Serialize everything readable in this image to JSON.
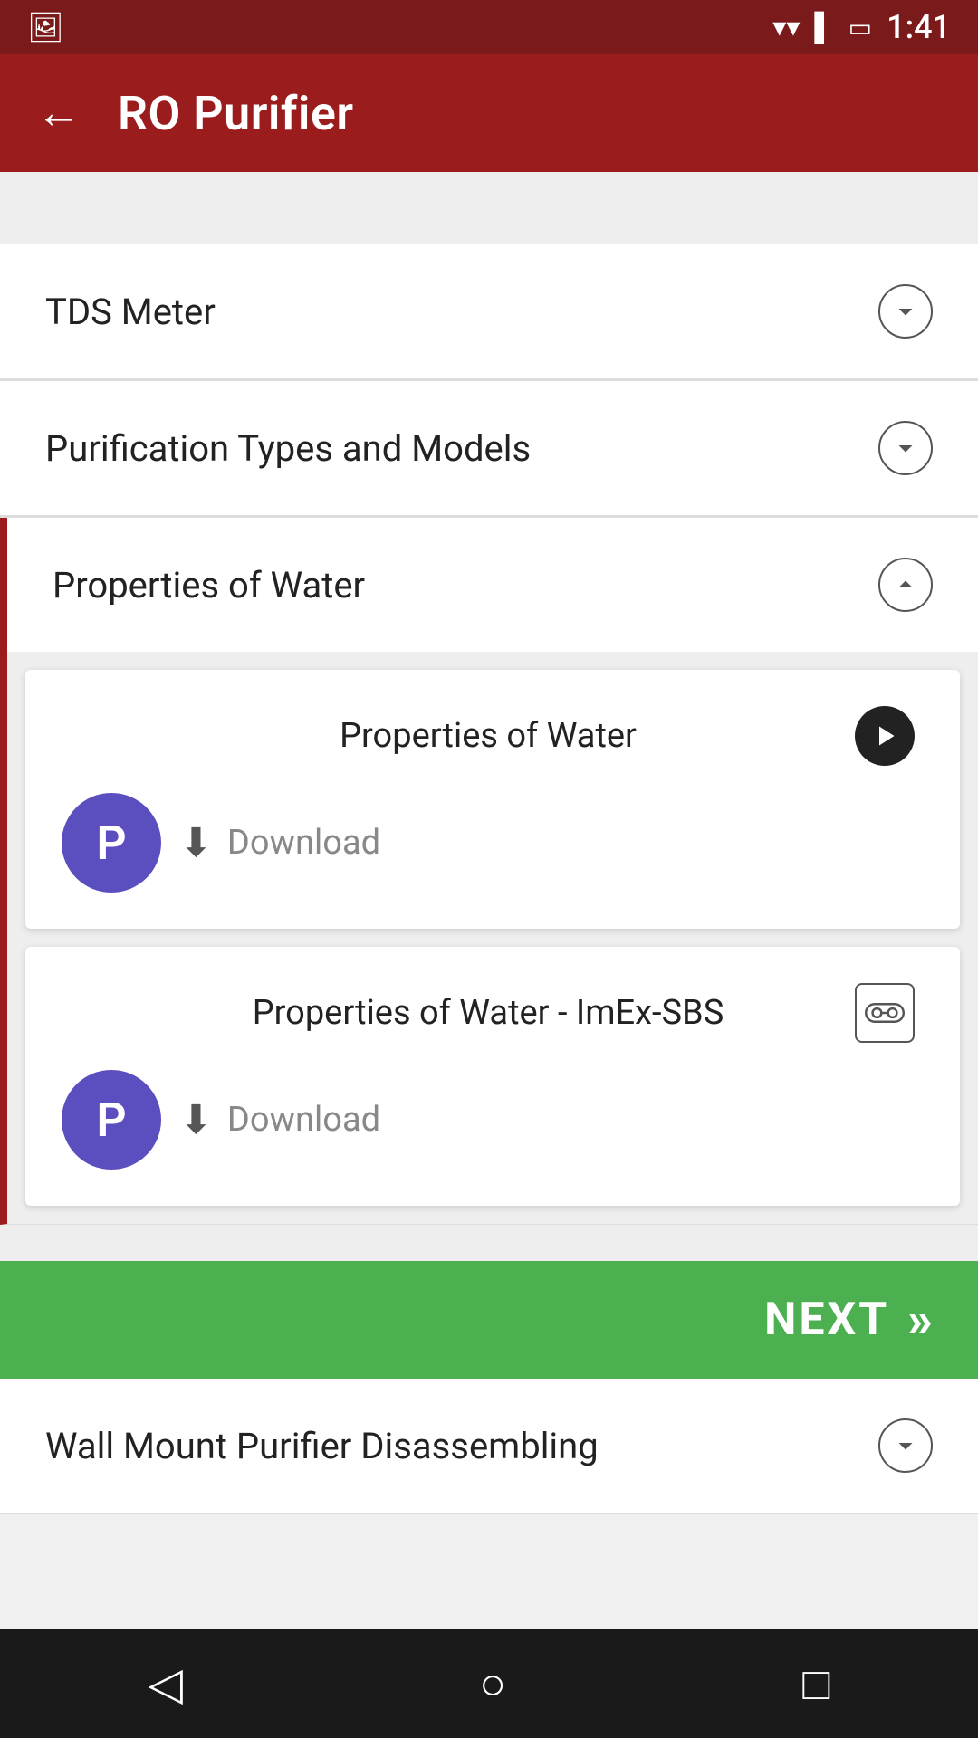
{
  "status_bar": {
    "time": "1:41",
    "bg_color": "#7b1a1a"
  },
  "app_bar": {
    "title": "RO Purifier",
    "back_label": "←",
    "bg_color": "#9b1c1c"
  },
  "accordion": {
    "items": [
      {
        "id": "tds-meter",
        "label": "TDS Meter",
        "expanded": false,
        "chevron": "chevron-down"
      },
      {
        "id": "purification-types",
        "label": "Purification Types and Models",
        "expanded": false,
        "chevron": "chevron-down"
      },
      {
        "id": "properties-of-water",
        "label": "Properties of Water",
        "expanded": true,
        "chevron": "chevron-up"
      }
    ]
  },
  "cards": [
    {
      "id": "card-1",
      "title": "Properties of Water",
      "avatar_letter": "P",
      "action_type": "play",
      "download_label": "Download"
    },
    {
      "id": "card-2",
      "title": "Properties of Water - ImEx-SBS",
      "avatar_letter": "P",
      "action_type": "vr",
      "download_label": "Download"
    }
  ],
  "next_button": {
    "label": "NEXT",
    "arrows": "»"
  },
  "peek_item": {
    "label": "Wall Mount Purifier Disassembling"
  },
  "nav": {
    "back": "◁",
    "home": "○",
    "recent": "□"
  }
}
